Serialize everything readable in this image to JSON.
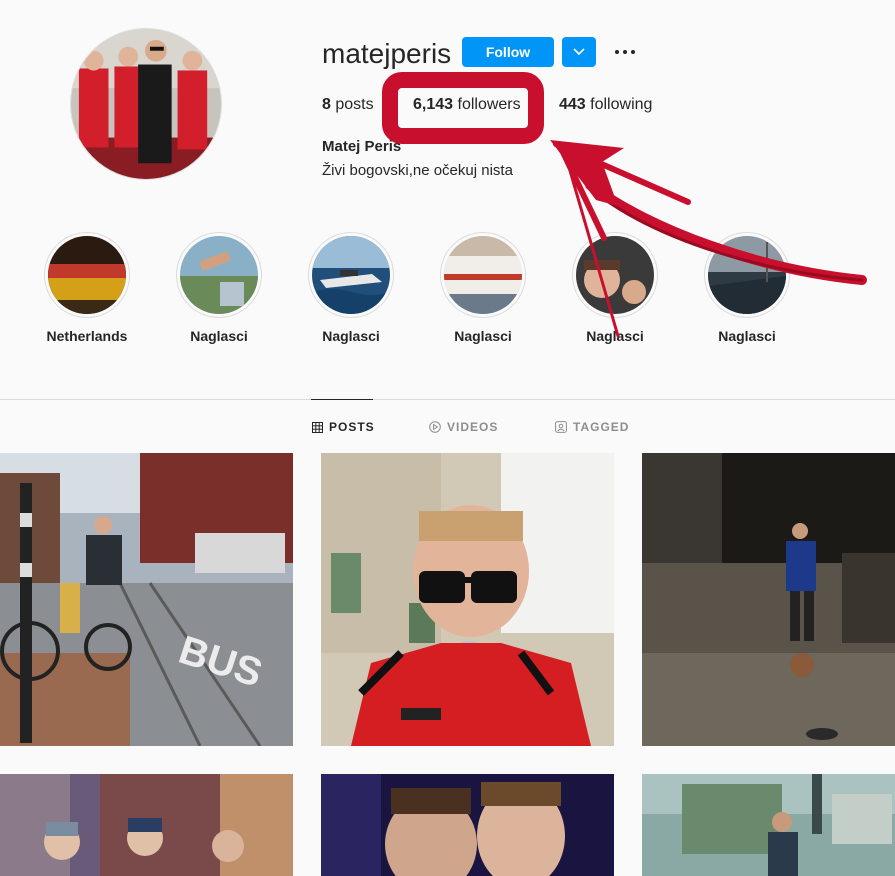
{
  "profile": {
    "username": "matejperis",
    "follow_label": "Follow",
    "posts_count": "8",
    "posts_label": "posts",
    "followers_count": "6,143",
    "followers_label": "followers",
    "following_count": "443",
    "following_label": "following",
    "full_name": "Matej Peris",
    "bio": "Živi bogovski,ne očekuj nista"
  },
  "highlights": [
    {
      "label": "Netherlands"
    },
    {
      "label": "Naglasci"
    },
    {
      "label": "Naglasci"
    },
    {
      "label": "Naglasci"
    },
    {
      "label": "Naglasci"
    },
    {
      "label": "Naglasci"
    }
  ],
  "tabs": [
    {
      "label": "POSTS",
      "icon": "grid-icon",
      "active": true
    },
    {
      "label": "VIDEOS",
      "icon": "play-circle-icon",
      "active": false
    },
    {
      "label": "TAGGED",
      "icon": "tag-portrait-icon",
      "active": false
    }
  ],
  "colors": {
    "follow_button": "#0095f6",
    "annotation_red": "#c8102e",
    "background": "#fafafa"
  }
}
